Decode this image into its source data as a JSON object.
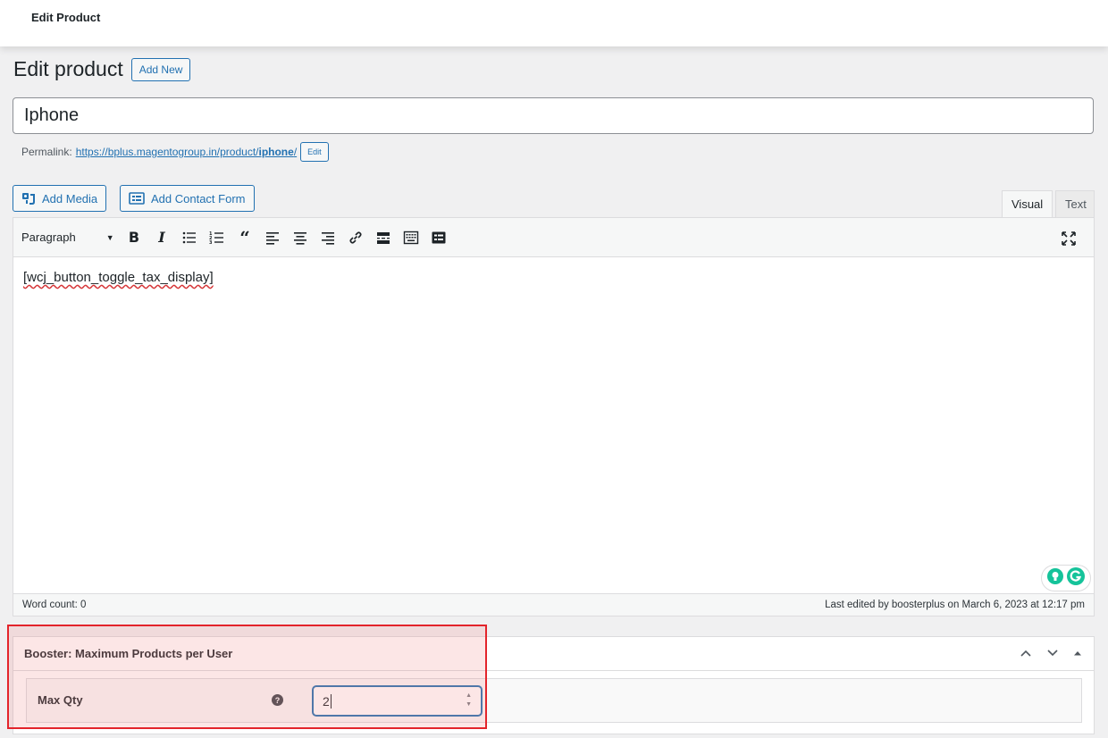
{
  "topbar": {
    "title": "Edit Product"
  },
  "heading": {
    "title": "Edit product",
    "add_new": "Add New"
  },
  "post_title": {
    "value": "Iphone"
  },
  "permalink": {
    "label": "Permalink:",
    "url_prefix": "https://bplus.magentogroup.in/product/",
    "slug": "iphone",
    "url_suffix": "/",
    "edit": "Edit"
  },
  "media_buttons": {
    "add_media": "Add Media",
    "add_contact_form": "Add Contact Form"
  },
  "editor_tabs": {
    "visual": "Visual",
    "text": "Text"
  },
  "toolbar": {
    "format_select": "Paragraph",
    "icons": [
      "bold-icon",
      "italic-icon",
      "bulleted-list-icon",
      "numbered-list-icon",
      "blockquote-icon",
      "align-left-icon",
      "align-center-icon",
      "align-right-icon",
      "link-icon",
      "read-more-icon",
      "toolbar-toggle-icon",
      "form-icon",
      "fullscreen-icon"
    ]
  },
  "editor": {
    "content": "[wcj_button_toggle_tax_display]"
  },
  "statusbar": {
    "word_count": "Word count: 0",
    "last_edited": "Last edited by boosterplus on March 6, 2023 at 12:17 pm"
  },
  "metabox": {
    "title": "Booster: Maximum Products per User",
    "field_label": "Max Qty",
    "field_value": "2"
  },
  "colors": {
    "accent": "#2271b1",
    "highlight_border": "#e3242b",
    "background": "#f0f0f1"
  }
}
